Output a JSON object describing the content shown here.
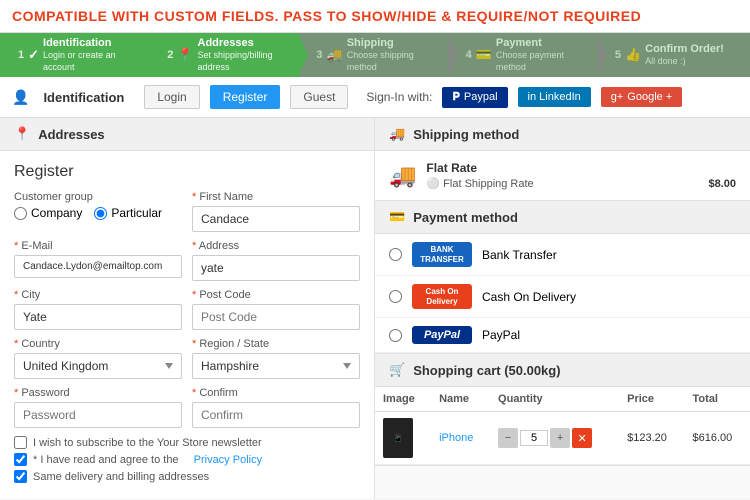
{
  "banner": {
    "text": "COMPATIBLE WITH CUSTOM FIELDS. PASS TO SHOW/HIDE & REQUIRE/NOT REQUIRED"
  },
  "progress": {
    "steps": [
      {
        "id": "identification",
        "number": "1",
        "icon": "✓",
        "title": "Identification",
        "sub": "Login or create an account",
        "active": true
      },
      {
        "id": "addresses",
        "number": "2",
        "icon": "📍",
        "title": "Addresses",
        "sub": "Set shipping/billing address",
        "active": true
      },
      {
        "id": "shipping",
        "number": "3",
        "icon": "🚚",
        "title": "Shipping",
        "sub": "Choose shipping method",
        "active": false
      },
      {
        "id": "payment",
        "number": "4",
        "icon": "💳",
        "title": "Payment",
        "sub": "Choose payment method",
        "active": false
      },
      {
        "id": "confirm",
        "number": "5",
        "icon": "👍",
        "title": "Confirm Order!",
        "sub": "All done :)",
        "active": false
      }
    ]
  },
  "identification_bar": {
    "icon": "👤",
    "label": "Identification",
    "tabs": [
      {
        "id": "login",
        "label": "Login",
        "active": false
      },
      {
        "id": "register",
        "label": "Register",
        "active": true
      },
      {
        "id": "guest",
        "label": "Guest",
        "active": false
      }
    ],
    "signin_label": "Sign-In with:",
    "social_buttons": [
      {
        "id": "paypal",
        "label": "Paypal",
        "icon": "P"
      },
      {
        "id": "linkedin",
        "label": "in LinkedIn",
        "icon": "in"
      },
      {
        "id": "google",
        "label": "Google +",
        "icon": "g+"
      }
    ]
  },
  "addresses_section": {
    "icon": "📍",
    "label": "Addresses"
  },
  "form": {
    "title": "Register",
    "customer_group_label": "Customer group",
    "company_radio": "Company",
    "particular_radio": "Particular",
    "first_name_label": "First Name",
    "first_name_value": "Candace",
    "email_label": "E-Mail",
    "email_value": "Candace.Lydon@emailtop.com",
    "address_label": "Address",
    "address_value": "yate",
    "city_label": "City",
    "city_value": "Yate",
    "post_code_label": "Post Code",
    "post_code_placeholder": "Post Code",
    "country_label": "Country",
    "country_value": "United Kingdom",
    "region_label": "Region / State",
    "region_value": "Hampshire",
    "password_label": "Password",
    "password_placeholder": "Password",
    "confirm_label": "Confirm",
    "confirm_placeholder": "Confirm",
    "newsletter_checkbox": "I wish to subscribe to the Your Store newsletter",
    "privacy_text": "* I have read and agree to the",
    "privacy_link": "Privacy Policy",
    "same_address_checkbox": "Same delivery and billing addresses"
  },
  "shipping_method": {
    "icon": "🚚",
    "label": "Shipping method",
    "rate_name": "Flat Rate",
    "rate_sub": "Flat Shipping Rate",
    "rate_price": "$8.00"
  },
  "payment_method": {
    "icon": "💳",
    "label": "Payment method",
    "options": [
      {
        "id": "bank",
        "label": "Bank Transfer",
        "badge": "BANK TRANSFER"
      },
      {
        "id": "cash",
        "label": "Cash On Delivery",
        "badge": "Cash On Delivery"
      },
      {
        "id": "paypal",
        "label": "PayPal",
        "badge": "PayPal"
      }
    ]
  },
  "shopping_cart": {
    "icon": "🛒",
    "label": "Shopping cart (50.00kg)",
    "columns": [
      "Image",
      "Name",
      "Quantity",
      "Price",
      "Total"
    ],
    "items": [
      {
        "id": "iphone",
        "name": "iPhone",
        "quantity": 5,
        "price": "$123.20",
        "total": "$616.00"
      }
    ]
  }
}
